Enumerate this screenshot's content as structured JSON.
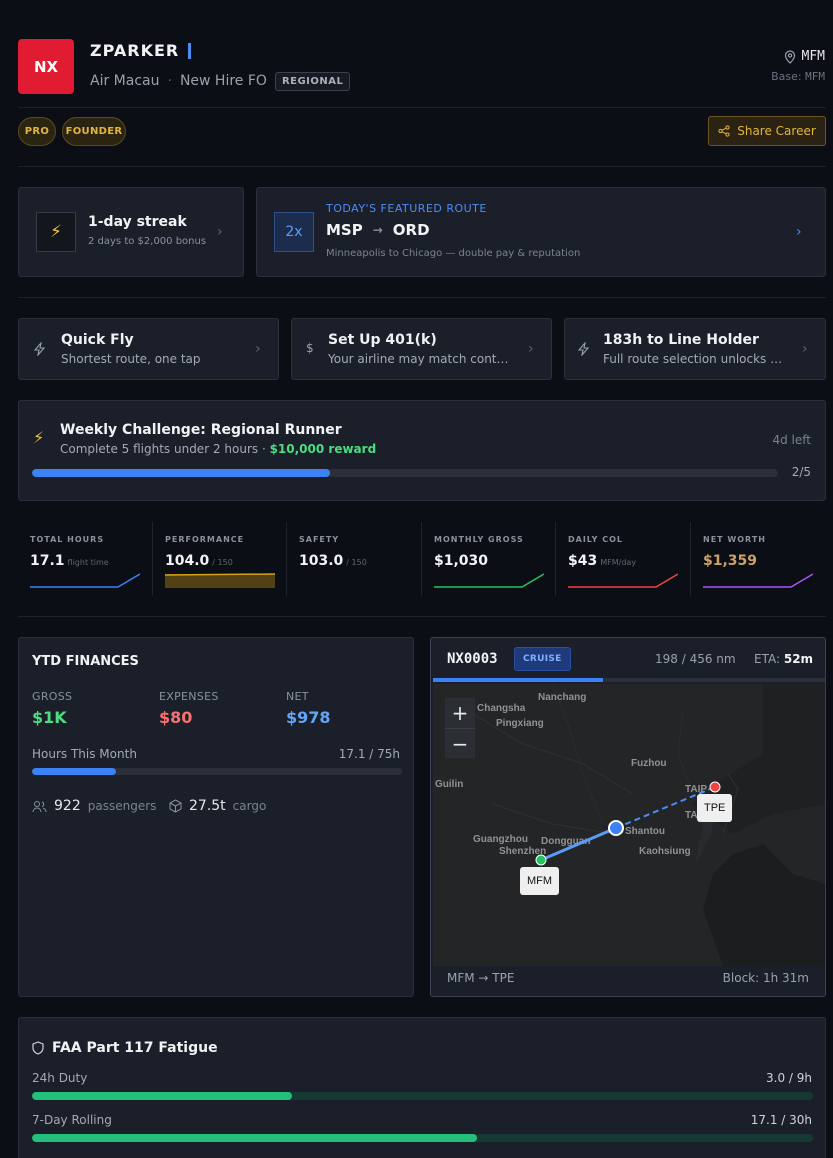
{
  "header": {
    "logo_text": "NX",
    "pilot_name": "ZPARKER",
    "airline": "Air Macau",
    "rank": "New Hire FO",
    "class_tag": "REGIONAL",
    "location": "MFM",
    "base_label": "Base:",
    "base_value": "MFM",
    "badges": [
      "PRO",
      "FOUNDER"
    ],
    "share_label": "Share Career"
  },
  "streak": {
    "icon": "bolt-icon",
    "title": "1-day streak",
    "subtitle": "2 days to $2,000 bonus"
  },
  "featured": {
    "multiplier": "2x",
    "eyebrow": "TODAY'S FEATURED ROUTE",
    "from": "MSP",
    "arrow": "→",
    "to": "ORD",
    "description": "Minneapolis to Chicago — double pay & reputation"
  },
  "quick_cards": [
    {
      "icon": "bolt-outline-icon",
      "title": "Quick Fly",
      "subtitle": "Shortest route, one tap"
    },
    {
      "icon": "dollar-icon",
      "title": "Set Up 401(k)",
      "subtitle": "Your airline may match contri..."
    },
    {
      "icon": "bolt-outline-icon",
      "title": "183h to Line Holder",
      "subtitle": "Full route selection unlocks a..."
    }
  ],
  "weekly_challenge": {
    "title": "Weekly Challenge: Regional Runner",
    "subtitle": "Complete 5 flights under 2 hours · ",
    "reward": "$10,000 reward",
    "time_left": "4d left",
    "progress_text": "2/5",
    "progress": 0.4
  },
  "stats": [
    {
      "label": "TOTAL HOURS",
      "value": "17.1",
      "suffix": "flight time",
      "color": "#3b82f6"
    },
    {
      "label": "PERFORMANCE",
      "value": "104.0",
      "suffix": "/ 150",
      "color": "#d4a017"
    },
    {
      "label": "SAFETY",
      "value": "103.0",
      "suffix": "/ 150",
      "color": "#6b7280"
    },
    {
      "label": "MONTHLY GROSS",
      "value": "$1,030",
      "suffix": "",
      "color": "#22c55e"
    },
    {
      "label": "DAILY COL",
      "value": "$43",
      "suffix": "MFM/day",
      "color": "#ef4444"
    },
    {
      "label": "NET WORTH",
      "value": "$1,359",
      "suffix": "",
      "color": "#a855f7",
      "value_color": "#c9a26b"
    }
  ],
  "finances": {
    "title": "YTD FINANCES",
    "gross_label": "GROSS",
    "gross_value": "$1K",
    "gross_color": "#4ade80",
    "expenses_label": "EXPENSES",
    "expenses_value": "$80",
    "expenses_color": "#f87171",
    "net_label": "NET",
    "net_value": "$978",
    "net_color": "#60a5fa",
    "hours_label": "Hours This Month",
    "hours_value": "17.1 / 75h",
    "hours_progress": 0.228,
    "passengers_value": "922",
    "passengers_label": "passengers",
    "cargo_value": "27.5t",
    "cargo_label": "cargo"
  },
  "flight": {
    "number": "NX0003",
    "phase": "CRUISE",
    "distance": "198 / 456 nm",
    "eta_label": "ETA:",
    "eta_value": "52m",
    "progress": 0.434,
    "route": "MFM → TPE",
    "block": "Block: 1h 31m",
    "origin": "MFM",
    "destination": "TPE",
    "zoom_in": "+",
    "zoom_out": "−",
    "map_labels": [
      "Nanchang",
      "Changsha",
      "Pingxiang",
      "Fuzhou",
      "Guilin",
      "Guangzhou",
      "Dongguan",
      "Shenzhen",
      "Shantou",
      "Kaohsiung",
      "TAIP",
      "TA"
    ]
  },
  "fatigue": {
    "title": "FAA Part 117 Fatigue",
    "rows": [
      {
        "label": "24h Duty",
        "value": "3.0 / 9h",
        "progress": 0.333
      },
      {
        "label": "7-Day Rolling",
        "value": "17.1 / 30h",
        "progress": 0.57
      }
    ]
  }
}
